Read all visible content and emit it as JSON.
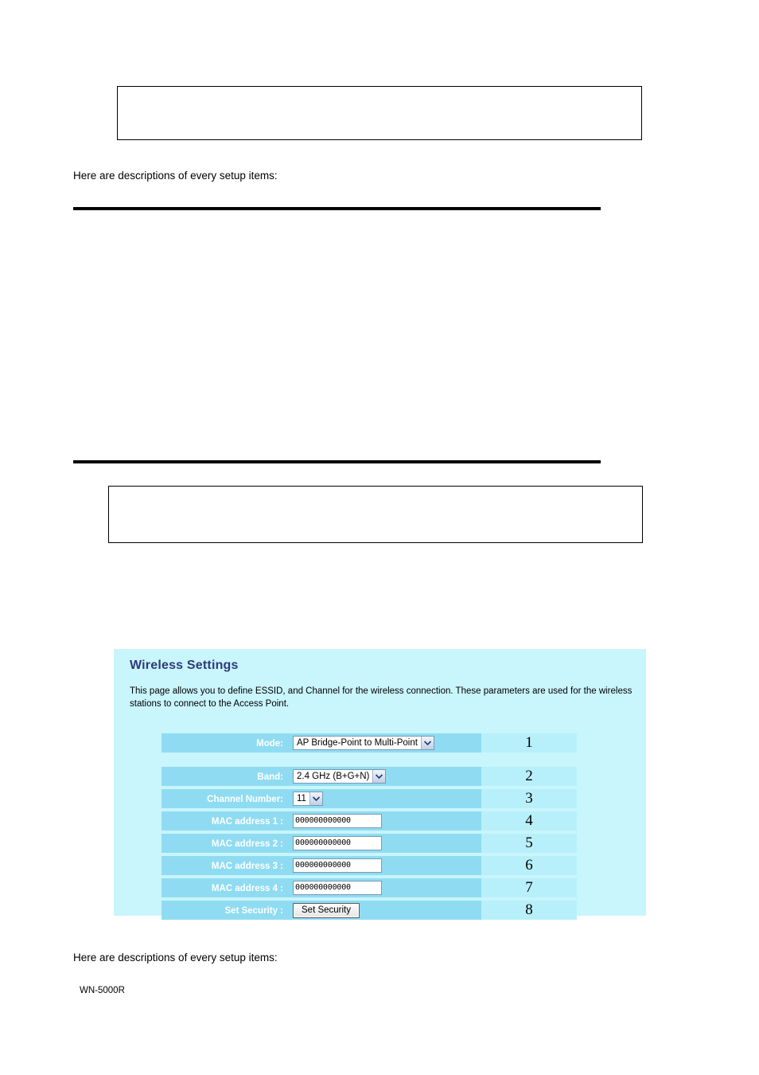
{
  "page": {
    "instruction_top": "Here are descriptions of every setup items:",
    "instruction_bottom": "Here are descriptions of every setup items:",
    "footer_model": "WN-5000R"
  },
  "boxes": {
    "top_box_content": "",
    "middle_box_content": ""
  },
  "panel": {
    "title": "Wireless Settings",
    "description": "This page allows you to define ESSID, and Channel for the wireless connection. These parameters are used for the wireless stations to connect to the Access Point.",
    "background_color": "#c9f5fd",
    "title_color": "#2c3b7a",
    "label_bg_color": "#8fdcf2",
    "number_bg_color": "#b7f0fb",
    "rows": [
      {
        "label": "Mode:",
        "control": "select",
        "value": "AP Bridge-Point to Multi-Point",
        "number": "1",
        "name": "mode"
      },
      {
        "label": "Band:",
        "control": "select",
        "value": "2.4 GHz (B+G+N)",
        "number": "2",
        "name": "band"
      },
      {
        "label": "Channel Number:",
        "control": "select",
        "value": "11",
        "number": "3",
        "name": "channel-number"
      },
      {
        "label": "MAC address 1 :",
        "control": "text",
        "value": "000000000000",
        "number": "4",
        "name": "mac-address-1"
      },
      {
        "label": "MAC address 2 :",
        "control": "text",
        "value": "000000000000",
        "number": "5",
        "name": "mac-address-2"
      },
      {
        "label": "MAC address 3 :",
        "control": "text",
        "value": "000000000000",
        "number": "6",
        "name": "mac-address-3"
      },
      {
        "label": "MAC address 4 :",
        "control": "text",
        "value": "000000000000",
        "number": "7",
        "name": "mac-address-4"
      },
      {
        "label": "Set Security :",
        "control": "button",
        "value": "Set Security",
        "number": "8",
        "name": "set-security"
      }
    ]
  }
}
